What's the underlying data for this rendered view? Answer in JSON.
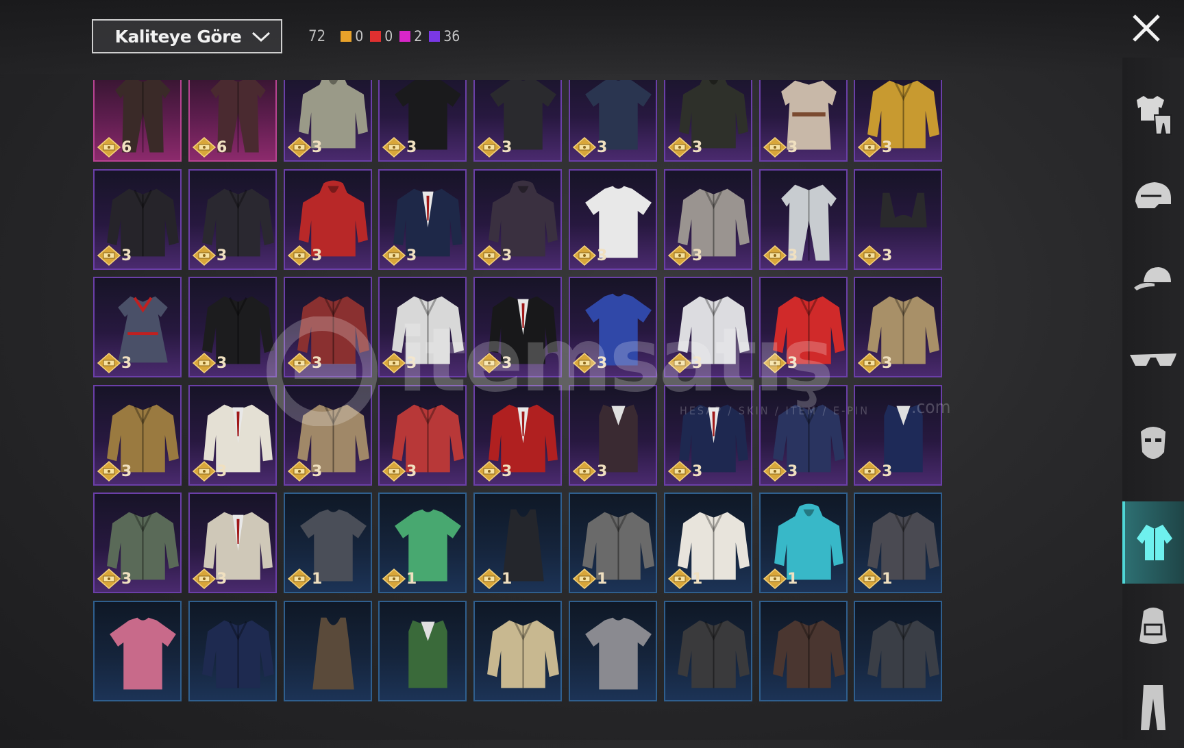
{
  "sort": {
    "label": "Kaliteye Göre"
  },
  "counts": {
    "total": "72",
    "chips": [
      {
        "color": "#e8a22a",
        "value": "0"
      },
      {
        "color": "#e03030",
        "value": "0"
      },
      {
        "color": "#d826c8",
        "value": "2"
      },
      {
        "color": "#7a38e6",
        "value": "36"
      }
    ]
  },
  "watermark": {
    "brand": "itemsatış",
    "tagline": "HESAP / SKIN / ITEM / E-PIN",
    "suffix": ".com"
  },
  "rail": {
    "items": [
      {
        "name": "outfit-icon",
        "active": false
      },
      {
        "name": "helmet-icon",
        "active": false
      },
      {
        "name": "cap-icon",
        "active": false
      },
      {
        "name": "glasses-icon",
        "active": false
      },
      {
        "name": "mask-icon",
        "active": false
      },
      {
        "name": "jacket-icon",
        "active": true
      },
      {
        "name": "backpack-icon",
        "active": false
      },
      {
        "name": "pants-icon",
        "active": false
      }
    ]
  },
  "items": [
    {
      "rarity": "pink",
      "price": "6",
      "art": "coat",
      "color": "#3a2a28"
    },
    {
      "rarity": "pink",
      "price": "6",
      "art": "coat",
      "color": "#4a2a30"
    },
    {
      "rarity": "purple",
      "price": "3",
      "art": "hoodie",
      "color": "#9a9a88"
    },
    {
      "rarity": "purple",
      "price": "3",
      "art": "tee",
      "color": "#1a1a1c"
    },
    {
      "rarity": "purple",
      "price": "3",
      "art": "tee",
      "color": "#2a2a2e"
    },
    {
      "rarity": "purple",
      "price": "3",
      "art": "tee",
      "color": "#2a3550"
    },
    {
      "rarity": "purple",
      "price": "3",
      "art": "hoodie",
      "color": "#2e302a"
    },
    {
      "rarity": "purple",
      "price": "3",
      "art": "apron",
      "color": "#c8b8a8"
    },
    {
      "rarity": "purple",
      "price": "3",
      "art": "jacket",
      "color": "#c89a30"
    },
    {
      "rarity": "purple",
      "price": "3",
      "art": "jacket",
      "color": "#26242a"
    },
    {
      "rarity": "purple",
      "price": "3",
      "art": "jacket",
      "color": "#2a2830"
    },
    {
      "rarity": "purple",
      "price": "3",
      "art": "hoodie",
      "color": "#b82828"
    },
    {
      "rarity": "purple",
      "price": "3",
      "art": "blazer",
      "color": "#1e2848"
    },
    {
      "rarity": "purple",
      "price": "3",
      "art": "hoodie",
      "color": "#3a3040"
    },
    {
      "rarity": "purple",
      "price": "3",
      "art": "tee",
      "color": "#e8e8e8"
    },
    {
      "rarity": "purple",
      "price": "3",
      "art": "jacket",
      "color": "#9a9490"
    },
    {
      "rarity": "purple",
      "price": "3",
      "art": "coat",
      "color": "#c8ccd0"
    },
    {
      "rarity": "purple",
      "price": "3",
      "art": "bra",
      "color": "#2a2a2c"
    },
    {
      "rarity": "purple",
      "price": "3",
      "art": "dress",
      "color": "#4a5068"
    },
    {
      "rarity": "purple",
      "price": "3",
      "art": "jacket",
      "color": "#1c1c1e"
    },
    {
      "rarity": "purple",
      "price": "3",
      "art": "jacket",
      "color": "#8a3030"
    },
    {
      "rarity": "purple",
      "price": "3",
      "art": "jacket",
      "color": "#d8d8d8"
    },
    {
      "rarity": "purple",
      "price": "3",
      "art": "blazer",
      "color": "#18181a"
    },
    {
      "rarity": "purple",
      "price": "3",
      "art": "tee",
      "color": "#3048a8"
    },
    {
      "rarity": "purple",
      "price": "3",
      "art": "jacket",
      "color": "#dcdce0"
    },
    {
      "rarity": "purple",
      "price": "3",
      "art": "jacket",
      "color": "#d02a2a"
    },
    {
      "rarity": "purple",
      "price": "3",
      "art": "jacket",
      "color": "#a89068"
    },
    {
      "rarity": "purple",
      "price": "3",
      "art": "jacket",
      "color": "#9a7a40"
    },
    {
      "rarity": "purple",
      "price": "3",
      "art": "blazer",
      "color": "#e4e0d4"
    },
    {
      "rarity": "purple",
      "price": "3",
      "art": "jacket",
      "color": "#a08868"
    },
    {
      "rarity": "purple",
      "price": "3",
      "art": "jacket",
      "color": "#b83838"
    },
    {
      "rarity": "purple",
      "price": "3",
      "art": "blazer",
      "color": "#b02020"
    },
    {
      "rarity": "purple",
      "price": "3",
      "art": "vest",
      "color": "#3a2a32"
    },
    {
      "rarity": "purple",
      "price": "3",
      "art": "blazer",
      "color": "#1e2850"
    },
    {
      "rarity": "purple",
      "price": "3",
      "art": "jacket",
      "color": "#2a3460"
    },
    {
      "rarity": "purple",
      "price": "3",
      "art": "vest",
      "color": "#1e2a58"
    },
    {
      "rarity": "purple",
      "price": "3",
      "art": "jacket",
      "color": "#5a6a58"
    },
    {
      "rarity": "purple",
      "price": "3",
      "art": "blazer",
      "color": "#cfc8b8"
    },
    {
      "rarity": "blue",
      "price": "1",
      "art": "tee",
      "color": "#4a4e58"
    },
    {
      "rarity": "blue",
      "price": "1",
      "art": "tee",
      "color": "#48a870"
    },
    {
      "rarity": "blue",
      "price": "1",
      "art": "tank",
      "color": "#24262c"
    },
    {
      "rarity": "blue",
      "price": "1",
      "art": "jacket",
      "color": "#6a6a6a"
    },
    {
      "rarity": "blue",
      "price": "1",
      "art": "jacket",
      "color": "#e8e4dc"
    },
    {
      "rarity": "blue",
      "price": "1",
      "art": "hoodie",
      "color": "#38b8c8"
    },
    {
      "rarity": "blue",
      "price": "1",
      "art": "jacket",
      "color": "#4a4a52"
    },
    {
      "rarity": "blue",
      "price": "",
      "art": "tee",
      "color": "#c86a8a"
    },
    {
      "rarity": "blue",
      "price": "",
      "art": "jacket",
      "color": "#1e2a50"
    },
    {
      "rarity": "blue",
      "price": "",
      "art": "tank",
      "color": "#5a4a3a"
    },
    {
      "rarity": "blue",
      "price": "",
      "art": "vest",
      "color": "#3a6a3a"
    },
    {
      "rarity": "blue",
      "price": "",
      "art": "jacket",
      "color": "#c8b890"
    },
    {
      "rarity": "blue",
      "price": "",
      "art": "tee",
      "color": "#8a8a90"
    },
    {
      "rarity": "blue",
      "price": "",
      "art": "jacket",
      "color": "#3a3a3c"
    },
    {
      "rarity": "blue",
      "price": "",
      "art": "jacket",
      "color": "#4a3630"
    },
    {
      "rarity": "blue",
      "price": "",
      "art": "jacket",
      "color": "#3a3e46"
    }
  ]
}
